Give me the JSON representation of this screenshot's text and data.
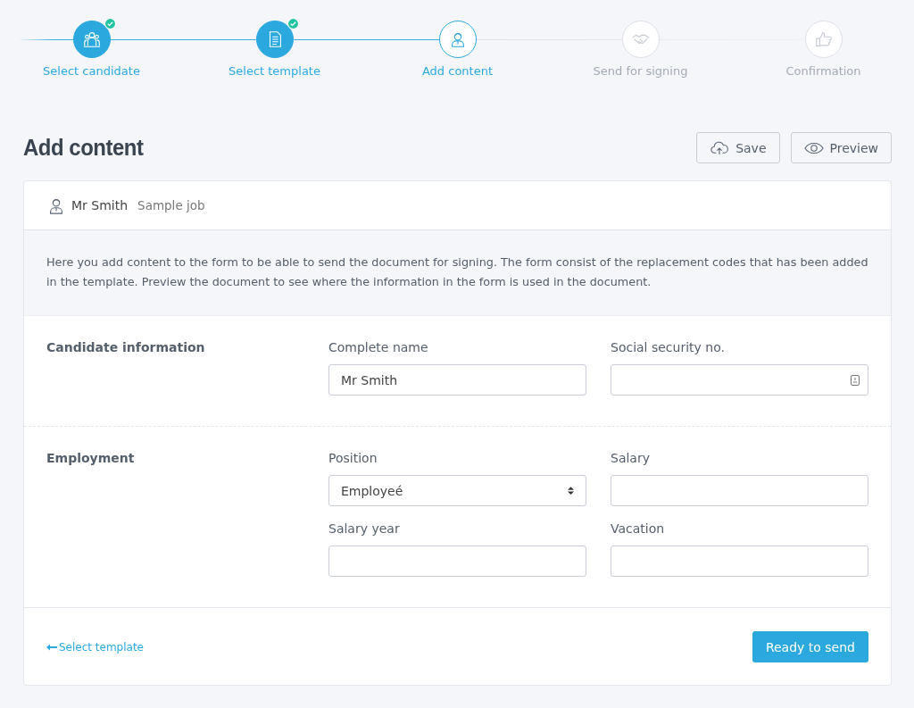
{
  "steps": [
    {
      "label": "Select candidate",
      "completed": true,
      "selected": false
    },
    {
      "label": "Select template",
      "completed": true,
      "selected": false
    },
    {
      "label": "Add content",
      "completed": false,
      "selected": true
    },
    {
      "label": "Send for signing",
      "completed": false,
      "selected": false
    },
    {
      "label": "Confirmation",
      "completed": false,
      "selected": false
    }
  ],
  "title": "Add content",
  "actions": [
    {
      "label": "Save"
    },
    {
      "label": "Preview"
    }
  ],
  "candidate": {
    "name": "Mr Smith",
    "job": "Sample job"
  },
  "intro": "Here you add content to the form to be able to send the document for signing. The form consist of the replacement codes that has been added in the template. Preview the document to see where the information in the form is used in the document.",
  "sections": [
    {
      "title": "Candidate information",
      "fields": [
        {
          "label": "Complete name",
          "kind": "text",
          "value": "Mr Smith"
        },
        {
          "label": "Social security no.",
          "kind": "id"
        }
      ]
    },
    {
      "title": "Employment",
      "fields": [
        {
          "label": "Position",
          "kind": "select",
          "value": "Employeé"
        },
        {
          "label": "Salary",
          "kind": "text"
        },
        {
          "label": "Salary year",
          "kind": "text"
        },
        {
          "label": "Vacation",
          "kind": "text"
        }
      ]
    }
  ],
  "back_link": "Select template",
  "submit": "Ready to send"
}
